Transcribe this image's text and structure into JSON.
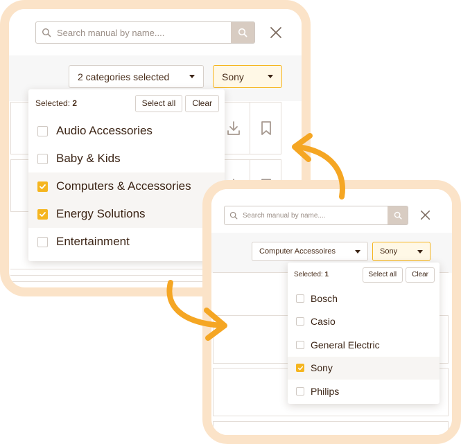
{
  "colors": {
    "frame": "#fbe3c8",
    "accent": "#f5b51f",
    "arrow": "#f5a623",
    "text": "#4a2f1c"
  },
  "screen1": {
    "search": {
      "placeholder": "Search manual by name....",
      "icon": "search-icon",
      "button_icon": "search-icon"
    },
    "close_icon": "close-icon",
    "filters": {
      "category_label": "2 categories selected",
      "brand_label": "Sony"
    },
    "dropdown": {
      "selected_label": "Selected:",
      "selected_count": "2",
      "select_all": "Select all",
      "clear": "Clear",
      "options": [
        {
          "label": "Audio Accessories",
          "checked": false
        },
        {
          "label": "Baby & Kids",
          "checked": false
        },
        {
          "label": "Computers & Accessories",
          "checked": true
        },
        {
          "label": "Energy Solutions",
          "checked": true
        },
        {
          "label": "Entertainment",
          "checked": false
        }
      ]
    },
    "row_icons": [
      "download-icon",
      "bookmark-icon"
    ]
  },
  "screen2": {
    "search": {
      "placeholder": "Search manual by name....",
      "icon": "search-icon",
      "button_icon": "search-icon"
    },
    "close_icon": "close-icon",
    "filters": {
      "category_label": "Computer Accessoires",
      "brand_label": "Sony"
    },
    "dropdown": {
      "selected_label": "Selected:",
      "selected_count": "1",
      "select_all": "Select all",
      "clear": "Clear",
      "options": [
        {
          "label": "Bosch",
          "checked": false
        },
        {
          "label": "Casio",
          "checked": false
        },
        {
          "label": "General Electric",
          "checked": false
        },
        {
          "label": "Sony",
          "checked": true
        },
        {
          "label": "Philips",
          "checked": false
        }
      ]
    }
  }
}
